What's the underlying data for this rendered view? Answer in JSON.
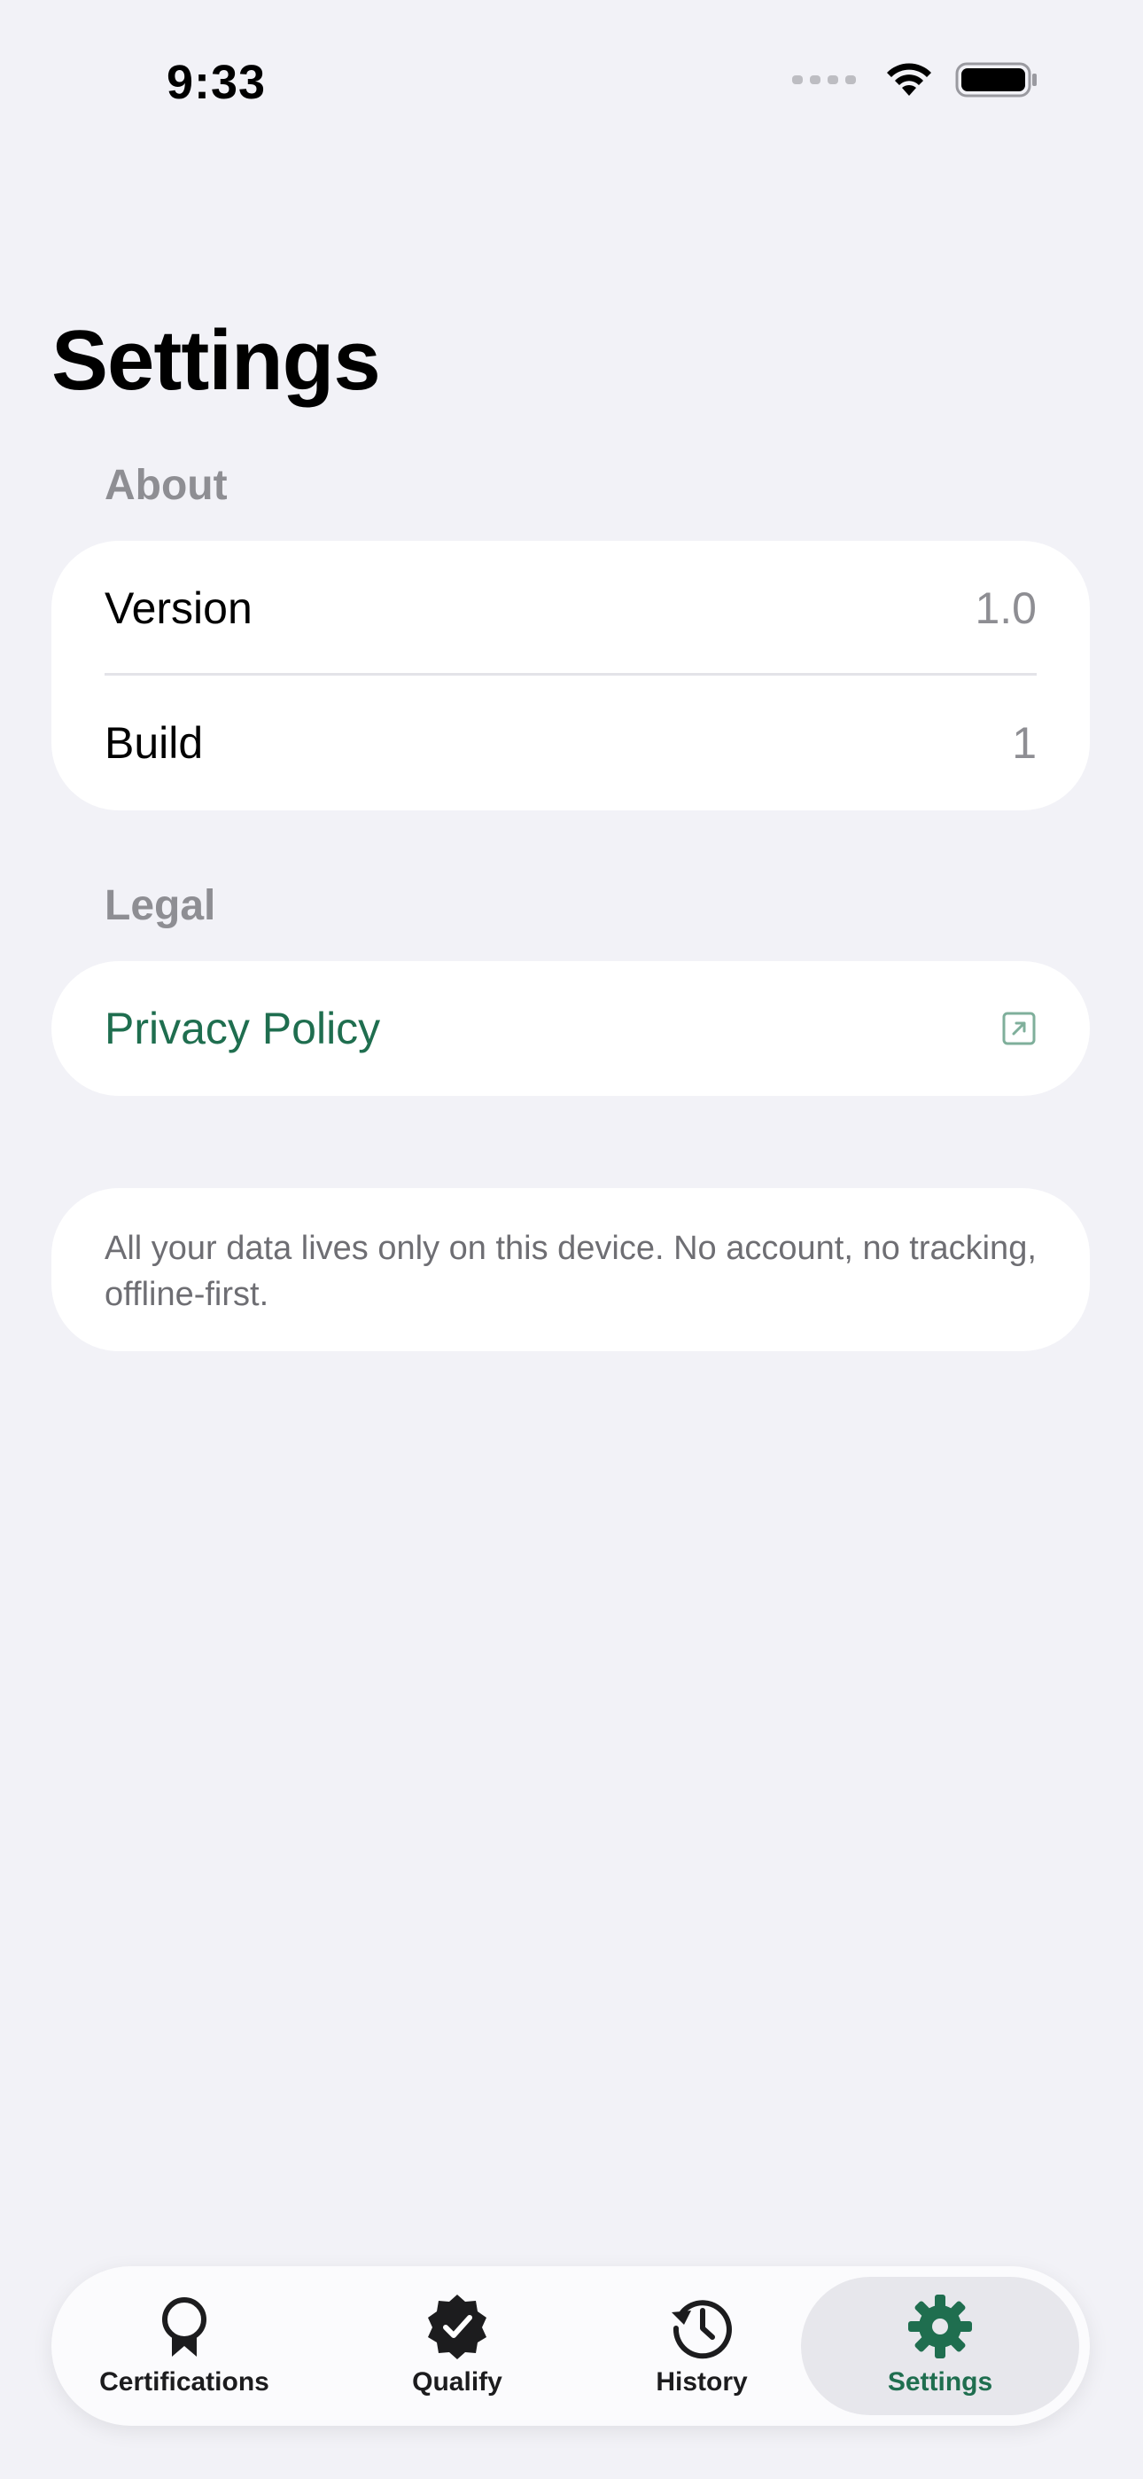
{
  "status_bar": {
    "time": "9:33"
  },
  "page": {
    "title": "Settings"
  },
  "about": {
    "header": "About",
    "rows": [
      {
        "label": "Version",
        "value": "1.0"
      },
      {
        "label": "Build",
        "value": "1"
      }
    ]
  },
  "legal": {
    "header": "Legal",
    "privacy_label": "Privacy Policy",
    "privacy_icon": "external-link-icon"
  },
  "note": {
    "text": "All your data lives only on this device. No account, no tracking, offline-first."
  },
  "tabbar": {
    "tabs": [
      {
        "label": "Certifications",
        "icon": "ribbon-icon"
      },
      {
        "label": "Qualify",
        "icon": "checkmark-seal-icon"
      },
      {
        "label": "History",
        "icon": "history-clock-icon"
      },
      {
        "label": "Settings",
        "icon": "gear-icon"
      }
    ],
    "selected": "Settings"
  },
  "colors": {
    "accent": "#1F6E4F",
    "background": "#F2F2F7",
    "card": "#FFFFFF",
    "secondary_text": "#8E8E93"
  }
}
